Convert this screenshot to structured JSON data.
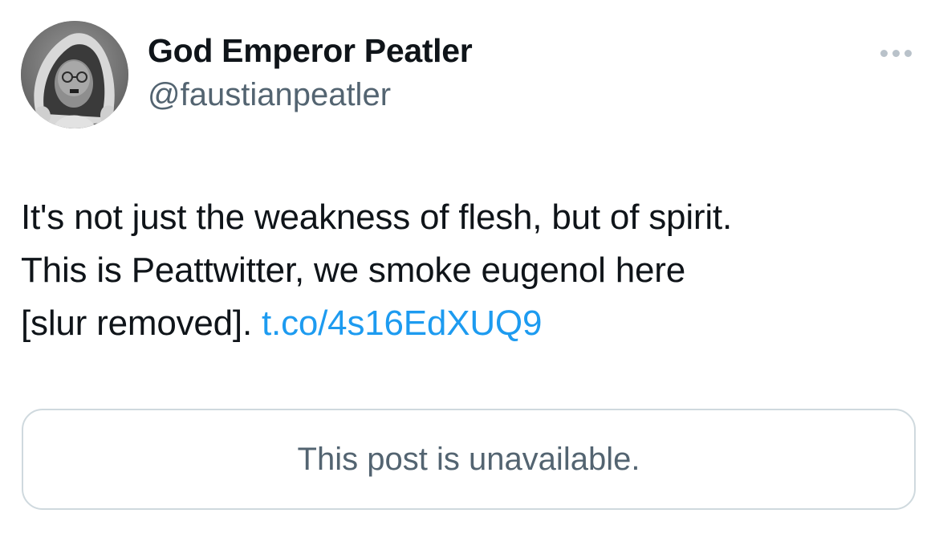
{
  "author": {
    "display_name": "God Emperor Peatler",
    "handle": "@faustianpeatler",
    "avatar_icon": "avatar-grayscale-portrait-icon"
  },
  "menu": {
    "icon": "more-options-icon"
  },
  "post": {
    "line1": "It's not just the weakness of flesh, but of spirit.",
    "line2": "This is Peattwitter, we smoke eugenol here",
    "line3_prefix": "[slur removed].",
    "link_text": "t.co/4s16EdXUQ9"
  },
  "quoted_post": {
    "status_text": "This post is unavailable."
  },
  "colors": {
    "text": "#0f1419",
    "secondary_text": "#536471",
    "link": "#1d9bf0",
    "border": "#cfd9de",
    "more_dots": "#b9c2ca"
  }
}
